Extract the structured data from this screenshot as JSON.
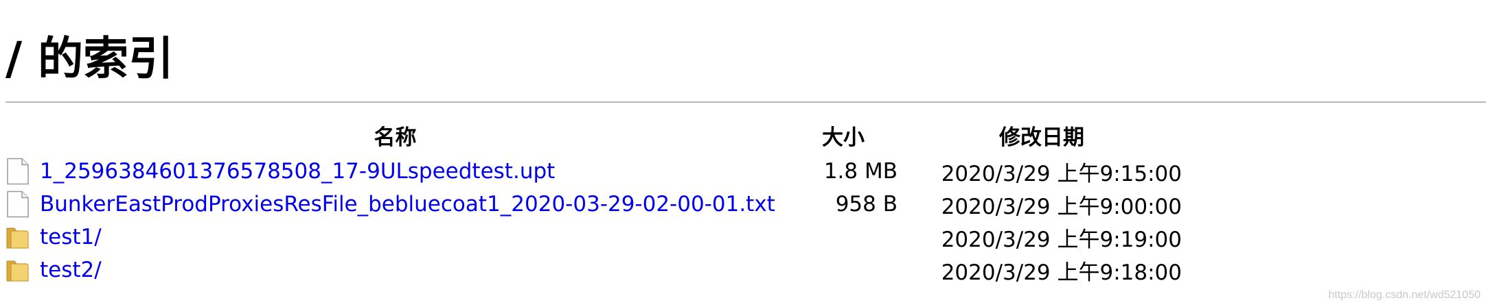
{
  "page": {
    "title": "/ 的索引"
  },
  "table": {
    "headers": {
      "name": "名称",
      "size": "大小",
      "modified": "修改日期"
    },
    "rows": [
      {
        "name": "1_2596384601376578508_17-9ULspeedtest.upt",
        "size": "1.8 MB",
        "modified": "2020/3/29 上午9:15:00",
        "icon": "file-icon"
      },
      {
        "name": "BunkerEastProdProxiesResFile_bebluecoat1_2020-03-29-02-00-01.txt",
        "size": "958 B",
        "modified": "2020/3/29 上午9:00:00",
        "icon": "file-icon"
      },
      {
        "name": "test1/",
        "size": "",
        "modified": "2020/3/29 上午9:19:00",
        "icon": "folder-icon"
      },
      {
        "name": "test2/",
        "size": "",
        "modified": "2020/3/29 上午9:18:00",
        "icon": "folder-icon"
      }
    ]
  },
  "watermark": "https://blog.csdn.net/wd521050",
  "colors": {
    "link": "#0000ee",
    "rule": "#b8b8b8",
    "folder": "#e8c25a"
  }
}
